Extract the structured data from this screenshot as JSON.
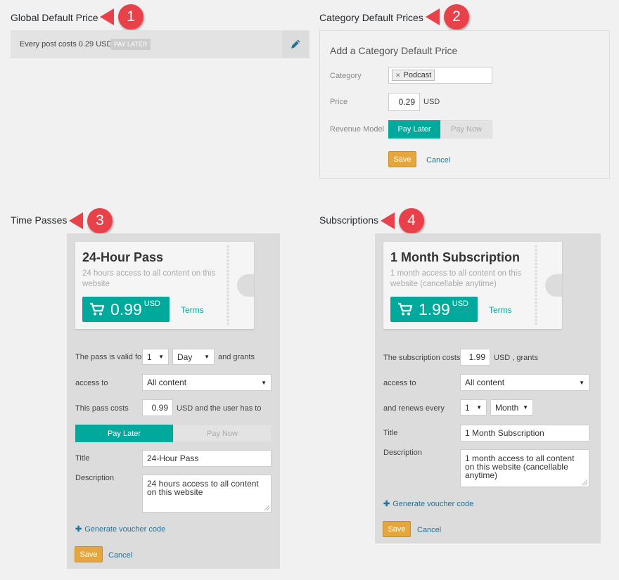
{
  "global": {
    "heading": "Global Default Price",
    "callout": "1",
    "text": "Every post costs 0.29 USD",
    "badge": "PAY LATER"
  },
  "category": {
    "heading": "Category Default Prices",
    "callout": "2",
    "box_title": "Add a Category Default Price",
    "category_label": "Category",
    "category_tag": "Podcast",
    "price_label": "Price",
    "price_value": "0.29",
    "price_currency": "USD",
    "revenue_label": "Revenue Model",
    "pay_later": "Pay Later",
    "pay_now": "Pay Now",
    "save": "Save",
    "cancel": "Cancel"
  },
  "timepasses": {
    "heading": "Time Passes",
    "callout": "3",
    "ticket_title": "24-Hour Pass",
    "ticket_desc": "24 hours access to all content on this website",
    "price": "0.99",
    "currency": "USD",
    "terms": "Terms",
    "valid_for_label": "The pass is valid for",
    "valid_num": "1",
    "valid_unit": "Day",
    "and_grants": "and grants",
    "access_to": "access to",
    "access_value": "All content",
    "pass_costs": "This pass costs",
    "cost_value": "0.99",
    "cost_suffix": "USD and the user has to",
    "pay_later": "Pay Later",
    "pay_now": "Pay Now",
    "title_label": "Title",
    "title_value": "24-Hour Pass",
    "desc_label": "Description",
    "desc_value": "24 hours access to all content on this website",
    "voucher": "Generate voucher code",
    "save": "Save",
    "cancel": "Cancel"
  },
  "subscriptions": {
    "heading": "Subscriptions",
    "callout": "4",
    "ticket_title": "1 Month Subscription",
    "ticket_desc": "1 month access to all content on this website (cancellable anytime)",
    "price": "1.99",
    "currency": "USD",
    "terms": "Terms",
    "costs_label": "The subscription costs",
    "cost_value": "1.99",
    "cost_suffix": "USD , grants",
    "access_to": "access to",
    "access_value": "All content",
    "renews_label": "and renews every",
    "renew_num": "1",
    "renew_unit": "Month",
    "title_label": "Title",
    "title_value": "1 Month Subscription",
    "desc_label": "Description",
    "desc_value": "1 month access to all content on this website (cancellable anytime)",
    "voucher": "Generate voucher code",
    "save": "Save",
    "cancel": "Cancel"
  },
  "colors": {
    "accent": "#01a99d",
    "save": "#e5a73d",
    "callout": "#e8414a",
    "link": "#21759b"
  }
}
